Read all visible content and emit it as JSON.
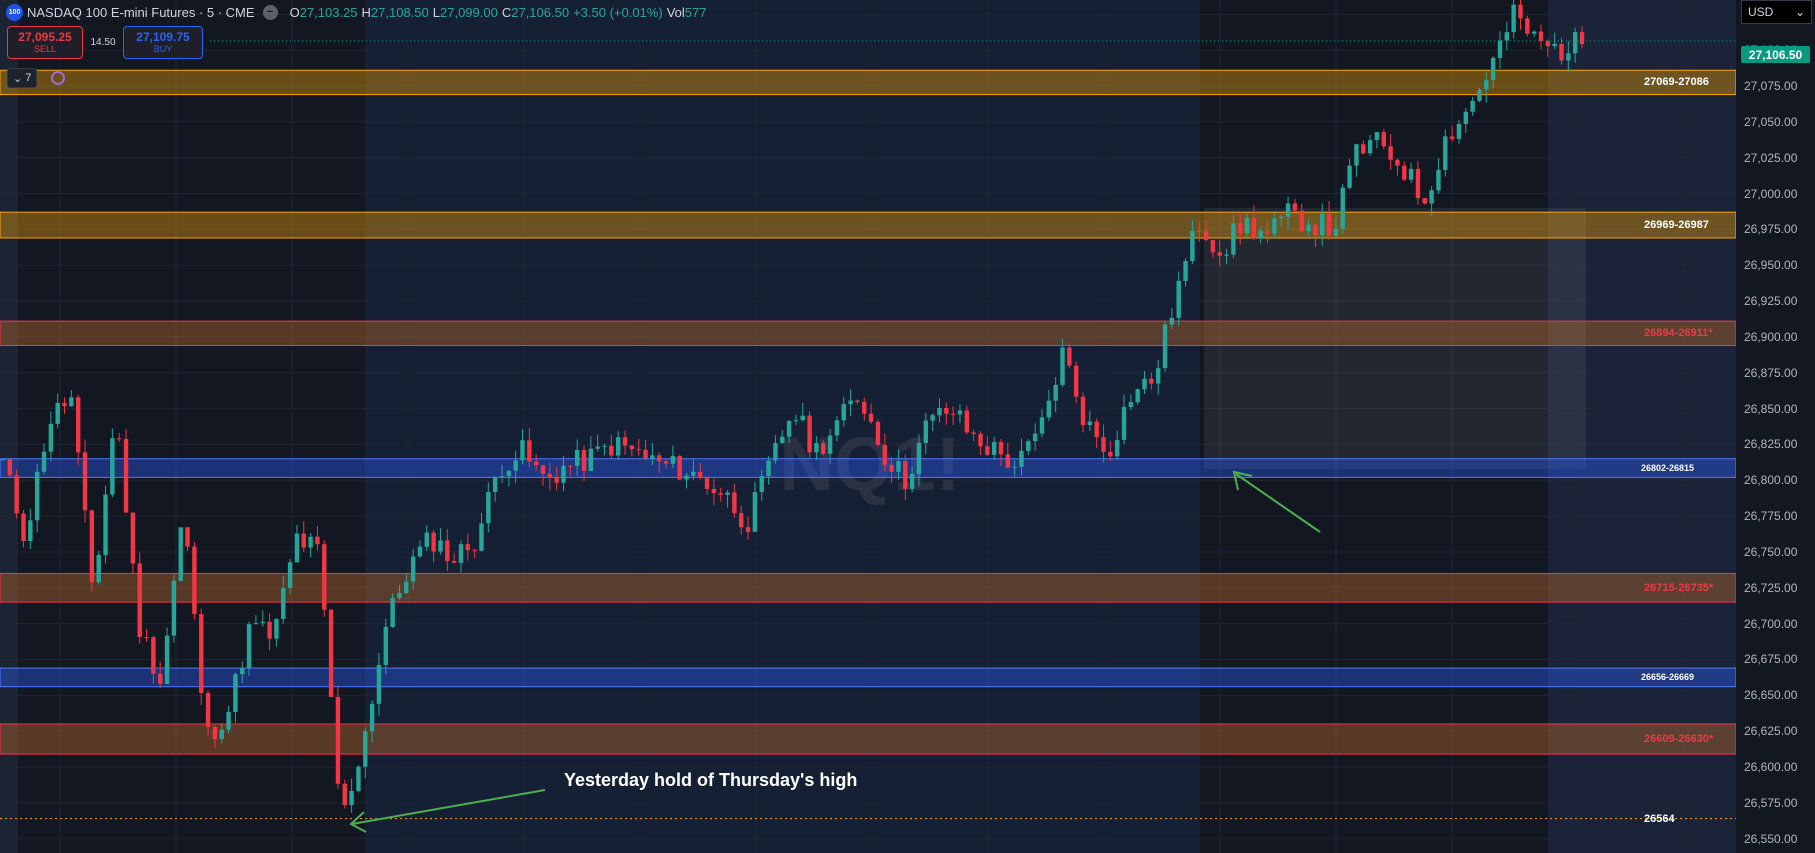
{
  "header": {
    "symbol_logo": "100",
    "symbol": "NASDAQ 100 E-mini Futures · 5 · CME",
    "hide_glyph": "−",
    "o_label": "O",
    "o_value": "27,103.25",
    "h_label": "H",
    "h_value": "27,108.50",
    "l_label": "L",
    "l_value": "27,099.00",
    "c_label": "C",
    "c_value": "27,106.50",
    "change": "+3.50 (+0.01%)",
    "vol_label": "Vol",
    "vol_value": "577"
  },
  "trade": {
    "sell_price": "27,095.25",
    "sell_label": "SELL",
    "spread": "14.50",
    "buy_price": "27,109.75",
    "buy_label": "BUY"
  },
  "indicators": {
    "toggle_icon": "chevron-down-icon",
    "toggle_glyph": "⌄",
    "count": "7",
    "sync_icon": "sync-icon"
  },
  "currency": {
    "value": "USD",
    "glyph": "⌄"
  },
  "watermark": "NQ1!",
  "price_axis": {
    "ticks": [
      "27,125.00",
      "27,100.00",
      "27,075.00",
      "27,050.00",
      "27,025.00",
      "27,000.00",
      "26,975.00",
      "26,950.00",
      "26,925.00",
      "26,900.00",
      "26,875.00",
      "26,850.00",
      "26,825.00",
      "26,800.00",
      "26,775.00",
      "26,750.00",
      "26,725.00",
      "26,700.00",
      "26,675.00",
      "26,650.00",
      "26,625.00",
      "26,600.00",
      "26,575.00",
      "26,550.00"
    ],
    "current_price": "27,106.50"
  },
  "zones": [
    {
      "label": "27069-27086",
      "low": 27069,
      "high": 27086,
      "kind": "orange",
      "label_color": "#ffffff"
    },
    {
      "label": "26969-26987",
      "low": 26969,
      "high": 26987,
      "kind": "orange",
      "label_color": "#ffffff"
    },
    {
      "label": "26894-26911*",
      "low": 26894,
      "high": 26911,
      "kind": "red",
      "label_color": "#f23645"
    },
    {
      "label": "26802-26815",
      "low": 26802,
      "high": 26815,
      "kind": "blue",
      "label_color": "#ffffff"
    },
    {
      "label": "26715-26735*",
      "low": 26715,
      "high": 26735,
      "kind": "red",
      "label_color": "#f23645"
    },
    {
      "label": "26656-26669",
      "low": 26656,
      "high": 26669,
      "kind": "blue",
      "label_color": "#ffffff"
    },
    {
      "label": "26609-26630*",
      "low": 26609,
      "high": 26630,
      "kind": "red",
      "label_color": "#f23645"
    }
  ],
  "level_line": {
    "label": "26564",
    "value": 26564
  },
  "annotation": "Yesterday hold of Thursday's high",
  "colors": {
    "up": "#26a69a",
    "down": "#f23645",
    "accent": "#2962ff",
    "orange_zone": "#f7a600",
    "red_zone": "#f23645",
    "blue_zone": "#2962ff",
    "arrow": "#4caf50"
  },
  "chart_data": {
    "type": "candlestick",
    "symbol": "NQ1!",
    "interval": "5",
    "ylim": [
      26540,
      27135
    ],
    "grid": true,
    "session_shading": true,
    "series": [
      {
        "name": "price",
        "values": [
          26812,
          26760,
          26840,
          26860,
          26720,
          26850,
          26700,
          26660,
          26780,
          26620,
          26640,
          26700,
          26690,
          26760,
          26750,
          26560,
          26620,
          26700,
          26740,
          26760,
          26745,
          26760,
          26810,
          26820,
          26800,
          26810,
          26815,
          26825,
          26820,
          26812,
          26808,
          26800,
          26790,
          26770,
          26810,
          26850,
          26820,
          26840,
          26860,
          26820,
          26800,
          26840,
          26850,
          26830,
          26820,
          26810,
          26835,
          26890,
          26840,
          26820,
          26860,
          26870,
          26930,
          26980,
          26960,
          26980,
          26970,
          26985,
          26980,
          26975,
          27030,
          27035,
          27020,
          26995,
          27040,
          27060,
          27090,
          27125,
          27105,
          27100,
          27106
        ]
      }
    ]
  }
}
